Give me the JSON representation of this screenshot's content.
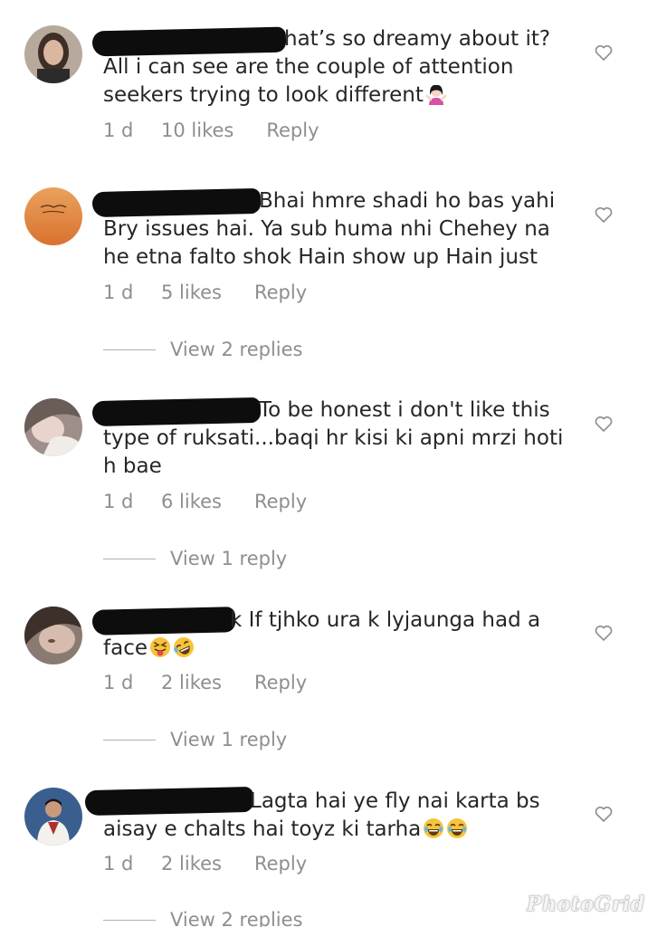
{
  "comments": [
    {
      "text": "hat’s so dreamy about it? All i can see are the couple of attention seekers trying to look different",
      "emoji_icons": [
        "woman-shrugging-icon"
      ],
      "time": "1 d",
      "likes": "10 likes",
      "reply": "Reply"
    },
    {
      "text": "Bhai hmre shadi ho bas yahi Bry issues hai. Ya sub huma nhi Chehey na he etna falto shok Hain show up Hain just",
      "emoji_icons": [],
      "time": "1 d",
      "likes": "5 likes",
      "reply": "Reply",
      "view_replies": "View 2 replies"
    },
    {
      "text": "To be honest i don't like this type of ruksati...baqi hr kisi ki apni mrzi hoti h bae",
      "emoji_icons": [],
      "time": "1 d",
      "likes": "6 likes",
      "reply": "Reply",
      "view_replies": "View 1 reply"
    },
    {
      "text": "k If tjhko ura k lyjaunga had a face",
      "emoji_icons": [
        "squinting-tongue-face-icon",
        "rolling-laughing-face-icon"
      ],
      "time": "1 d",
      "likes": "2 likes",
      "reply": "Reply",
      "view_replies": "View 1 reply"
    },
    {
      "text": "Lagta hai ye fly nai karta bs aisay e chalts hai toyz ki tarha",
      "emoji_icons": [
        "joy-face-icon",
        "joy-face-icon"
      ],
      "time": "1 d",
      "likes": "2 likes",
      "reply": "Reply",
      "view_replies": "View 2 replies"
    }
  ],
  "watermark": "PhotoGrid",
  "colors": {
    "text": "#262626",
    "secondary": "#8e8e8e",
    "redaction": "#0d0d0d"
  }
}
